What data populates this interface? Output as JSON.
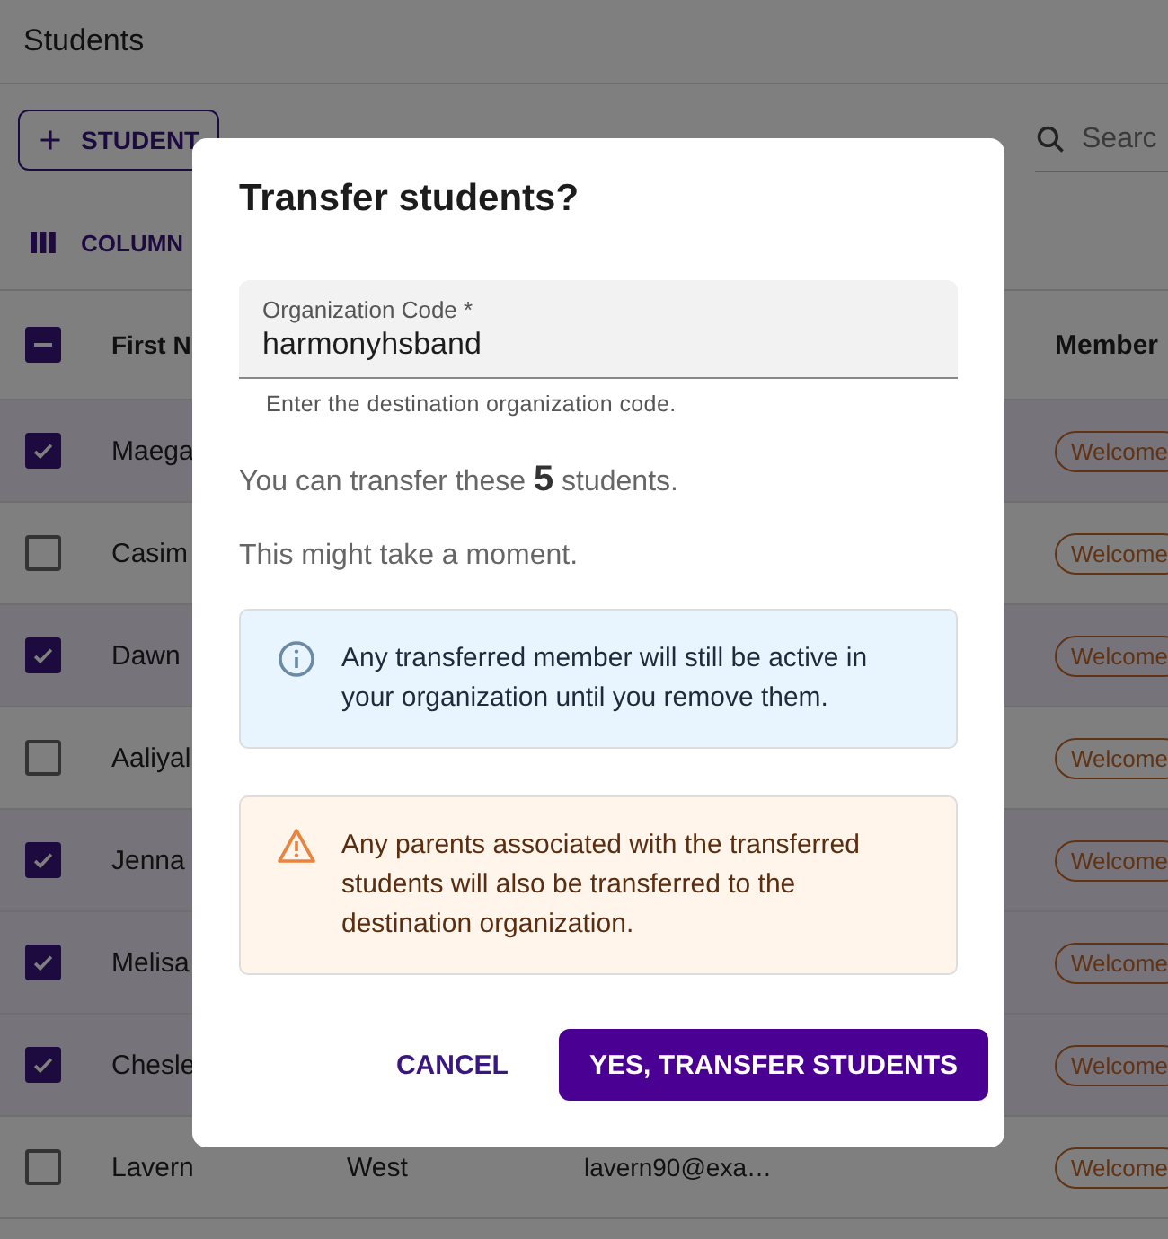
{
  "page": {
    "title": "Students"
  },
  "toolbar": {
    "add_button": "STUDENT",
    "columns_button": "COLUMN",
    "search": {
      "placeholder": "Searc"
    }
  },
  "table": {
    "header": {
      "indeterminate": true,
      "columns": [
        "First N",
        "Member"
      ]
    },
    "rows": [
      {
        "checked": true,
        "first_name": "Maega",
        "status": "Welcome"
      },
      {
        "checked": false,
        "first_name": "Casim",
        "status": "Welcome"
      },
      {
        "checked": true,
        "first_name": "Dawn",
        "status": "Welcome"
      },
      {
        "checked": false,
        "first_name": "Aaliyal",
        "status": "Welcome"
      },
      {
        "checked": true,
        "first_name": "Jenna",
        "status": "Welcome"
      },
      {
        "checked": true,
        "first_name": "Melisa",
        "status": "Welcome"
      },
      {
        "checked": true,
        "first_name": "Chesle",
        "status": "Welcome"
      },
      {
        "checked": false,
        "first_name": "Lavern",
        "last_name": "West",
        "email": "lavern90@exa…",
        "status": "Welcome"
      }
    ]
  },
  "dialog": {
    "title": "Transfer students?",
    "field": {
      "label": "Organization Code *",
      "value": "harmonyhsband",
      "helper": "Enter the destination organization code."
    },
    "messages": [
      "You can transfer these **5** students.",
      "This might take a moment."
    ],
    "alerts": [
      {
        "kind": "info",
        "text": "Any transferred member will still be active in your organization until you remove them."
      },
      {
        "kind": "warning",
        "text": "Any parents associated with the transferred students will also be transferred to the destination organization."
      }
    ],
    "buttons": {
      "cancel": "CANCEL",
      "confirm": "YES, TRANSFER STUDENTS"
    }
  }
}
